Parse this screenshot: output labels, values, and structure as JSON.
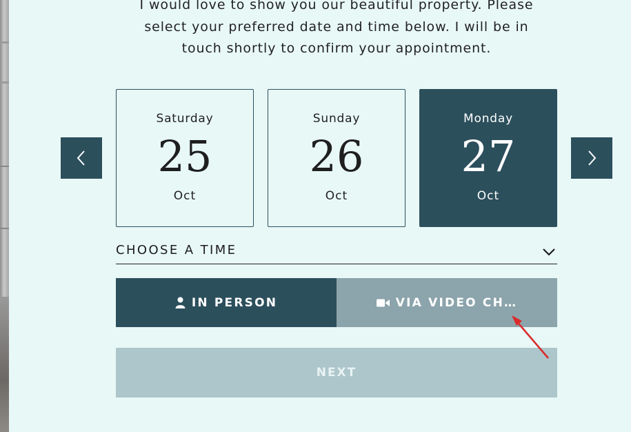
{
  "intro": {
    "line1": "I would love to show you our beautiful property. Please",
    "line2": "select your preferred date and time below. I will be in",
    "line3": "touch shortly to confirm your appointment."
  },
  "dates": [
    {
      "weekday": "Saturday",
      "day": "25",
      "month": "Oct",
      "selected": false
    },
    {
      "weekday": "Sunday",
      "day": "26",
      "month": "Oct",
      "selected": false
    },
    {
      "weekday": "Monday",
      "day": "27",
      "month": "Oct",
      "selected": true
    }
  ],
  "time_select": {
    "label": "CHOOSE A TIME"
  },
  "modes": {
    "in_person": "IN PERSON",
    "video": "VIA VIDEO CH…",
    "selected": "in_person"
  },
  "next_label": "NEXT",
  "colors": {
    "background": "#e8f8f7",
    "primary": "#2c4f5c",
    "secondary_button": "#8ca4ab",
    "disabled_button": "#adc6cb",
    "annotation_arrow": "#d92b2b"
  },
  "icons": {
    "prev": "chevron-left-icon",
    "next": "chevron-right-icon",
    "dropdown": "chevron-down-icon",
    "person": "user-icon",
    "video": "video-camera-icon"
  }
}
